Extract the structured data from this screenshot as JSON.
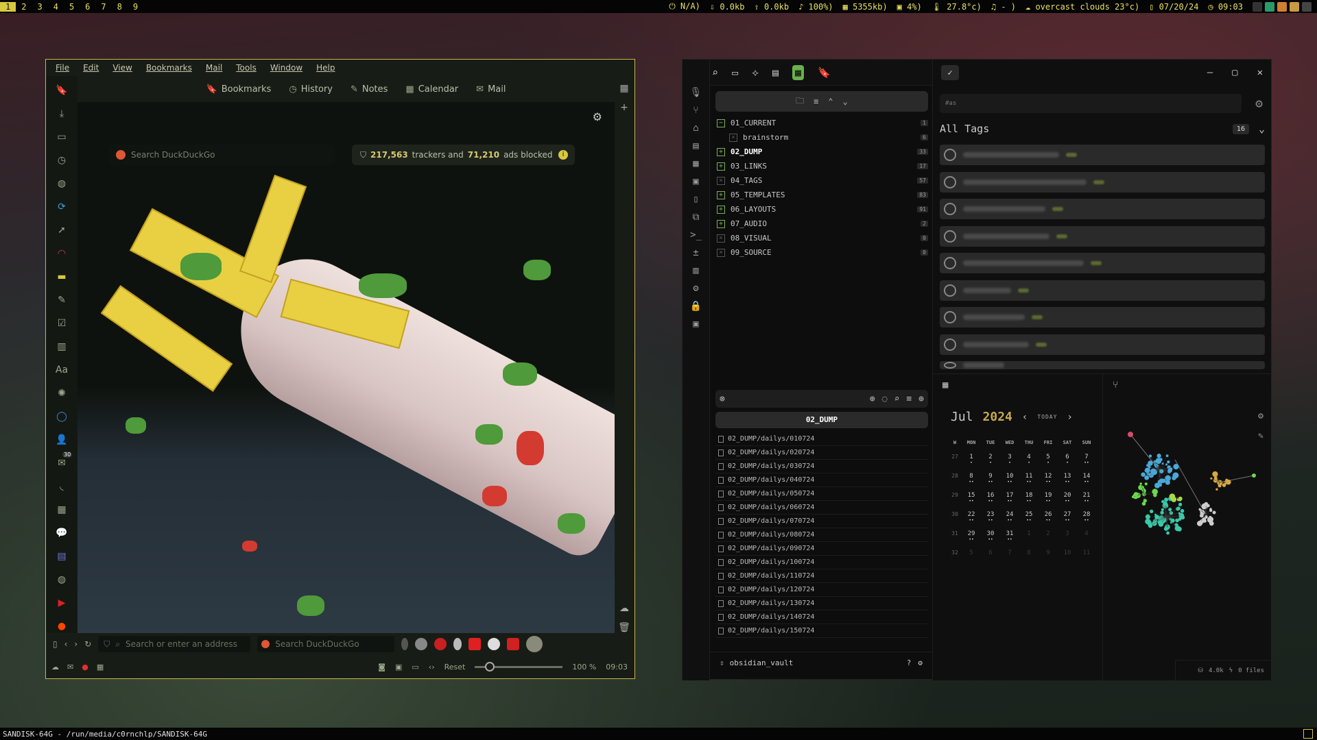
{
  "topbar": {
    "workspaces": [
      "1",
      "2",
      "3",
      "4",
      "5",
      "6",
      "7",
      "8",
      "9"
    ],
    "active_workspace": "1",
    "status": {
      "power": "N/A)",
      "down": "0.0kb",
      "up": "0.0kb",
      "volume": "100%)",
      "memory": "5355kb)",
      "cpu": "4%)",
      "temp": "27.8°c)",
      "music": "- )",
      "weather": "overcast clouds 23°c)",
      "date": "07/20/24",
      "time": "09:03"
    }
  },
  "bottombar": {
    "path_text": "SANDISK-64G - /run/media/c0rnchlp/SANDISK-64G"
  },
  "browser": {
    "menu": [
      "File",
      "Edit",
      "View",
      "Bookmarks",
      "Mail",
      "Tools",
      "Window",
      "Help"
    ],
    "toolbar": {
      "bookmarks": "Bookmarks",
      "history": "History",
      "notes": "Notes",
      "calendar": "Calendar",
      "mail": "Mail"
    },
    "search_placeholder": "Search DuckDuckGo",
    "trackers": {
      "trackers_count": "217,563",
      "trackers_label": "trackers and",
      "ads_count": "71,210",
      "ads_label": "ads blocked"
    },
    "address_placeholder": "Search or enter an address",
    "ddg_placeholder": "Search DuckDuckGo",
    "statusbar": {
      "reset": "Reset",
      "zoom": "100 %",
      "zoom_level": 100,
      "clock": "09:03"
    },
    "rail_badge": "30"
  },
  "obsidian": {
    "folders": [
      {
        "name": "01_CURRENT",
        "count": "1",
        "state": "open"
      },
      {
        "name": "brainstorm",
        "count": "6",
        "state": "child"
      },
      {
        "name": "02_DUMP",
        "count": "33",
        "state": "bold"
      },
      {
        "name": "03_LINKS",
        "count": "17",
        "state": "plus"
      },
      {
        "name": "04_TAGS",
        "count": "57",
        "state": "x"
      },
      {
        "name": "05_TEMPLATES",
        "count": "83",
        "state": "plus"
      },
      {
        "name": "06_LAYOUTS",
        "count": "91",
        "state": "plus"
      },
      {
        "name": "07_AUDIO",
        "count": "2",
        "state": "plus"
      },
      {
        "name": "08_VISUAL",
        "count": "0",
        "state": "x"
      },
      {
        "name": "09_SOURCE",
        "count": "0",
        "state": "x"
      }
    ],
    "dump_title": "02_DUMP",
    "dump_files": [
      "02_DUMP/dailys/010724",
      "02_DUMP/dailys/020724",
      "02_DUMP/dailys/030724",
      "02_DUMP/dailys/040724",
      "02_DUMP/dailys/050724",
      "02_DUMP/dailys/060724",
      "02_DUMP/dailys/070724",
      "02_DUMP/dailys/080724",
      "02_DUMP/dailys/090724",
      "02_DUMP/dailys/100724",
      "02_DUMP/dailys/110724",
      "02_DUMP/dailys/120724",
      "02_DUMP/dailys/130724",
      "02_DUMP/dailys/140724",
      "02_DUMP/dailys/150724"
    ],
    "vault_name": "obsidian_vault",
    "tag_search_placeholder": "#as",
    "all_tags_title": "All Tags",
    "all_tags_count": "16",
    "calendar": {
      "month": "Jul",
      "year": "2024",
      "today_label": "TODAY",
      "headers": [
        "W",
        "MON",
        "TUE",
        "WED",
        "THU",
        "FRI",
        "SAT",
        "SUN"
      ],
      "weeks": [
        {
          "wk": "27",
          "days": [
            "1",
            "2",
            "3",
            "4",
            "5",
            "6",
            "7"
          ],
          "dots": [
            "•",
            "•",
            "•",
            "•",
            "•",
            "•",
            "••"
          ]
        },
        {
          "wk": "28",
          "days": [
            "8",
            "9",
            "10",
            "11",
            "12",
            "13",
            "14"
          ],
          "dots": [
            "••",
            "••",
            "••",
            "••",
            "••",
            "••",
            "••"
          ]
        },
        {
          "wk": "29",
          "days": [
            "15",
            "16",
            "17",
            "18",
            "19",
            "20",
            "21"
          ],
          "dots": [
            "••",
            "••",
            "••",
            "••",
            "••",
            "••",
            "••"
          ]
        },
        {
          "wk": "30",
          "days": [
            "22",
            "23",
            "24",
            "25",
            "26",
            "27",
            "28"
          ],
          "dots": [
            "••",
            "••",
            "••",
            "••",
            "••",
            "••",
            "••"
          ]
        },
        {
          "wk": "31",
          "days": [
            "29",
            "30",
            "31",
            "1",
            "2",
            "3",
            "4"
          ],
          "dots": [
            "••",
            "••",
            "••",
            "",
            "",
            "",
            ""
          ]
        },
        {
          "wk": "32",
          "days": [
            "5",
            "6",
            "7",
            "8",
            "9",
            "10",
            "11"
          ],
          "dots": [
            "",
            "",
            "",
            "",
            "",
            "",
            ""
          ]
        }
      ]
    },
    "status": {
      "words": "4.0k",
      "files": "0 files"
    }
  },
  "colors": {
    "accent_yellow": "#d8c840",
    "obsidian_green": "#6ab04c",
    "calendar_year": "#c8a84a"
  }
}
